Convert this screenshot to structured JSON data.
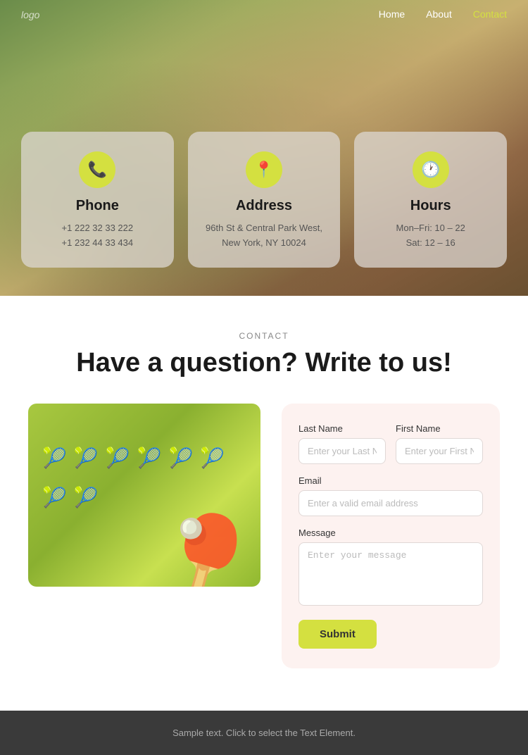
{
  "nav": {
    "logo": "logo",
    "links": [
      {
        "label": "Home",
        "active": false
      },
      {
        "label": "About",
        "active": false
      },
      {
        "label": "Contact",
        "active": true
      }
    ]
  },
  "cards": [
    {
      "id": "phone",
      "icon": "📞",
      "title": "Phone",
      "lines": [
        "+1 222 32 33 222",
        "+1 232 44 33 434"
      ]
    },
    {
      "id": "address",
      "icon": "📍",
      "title": "Address",
      "lines": [
        "96th St & Central Park West,",
        "New York, NY 10024"
      ]
    },
    {
      "id": "hours",
      "icon": "🕐",
      "title": "Hours",
      "lines": [
        "Mon–Fri: 10 – 22",
        "Sat: 12 – 16"
      ]
    }
  ],
  "contact": {
    "label": "CONTACT",
    "heading": "Have a question? Write to us!",
    "form": {
      "last_name_label": "Last Name",
      "last_name_placeholder": "Enter your Last Name",
      "first_name_label": "First Name",
      "first_name_placeholder": "Enter your First Name",
      "email_label": "Email",
      "email_placeholder": "Enter a valid email address",
      "message_label": "Message",
      "message_placeholder": "Enter your message",
      "submit_label": "Submit"
    }
  },
  "footer": {
    "text": "Sample text. Click to select the Text Element."
  }
}
